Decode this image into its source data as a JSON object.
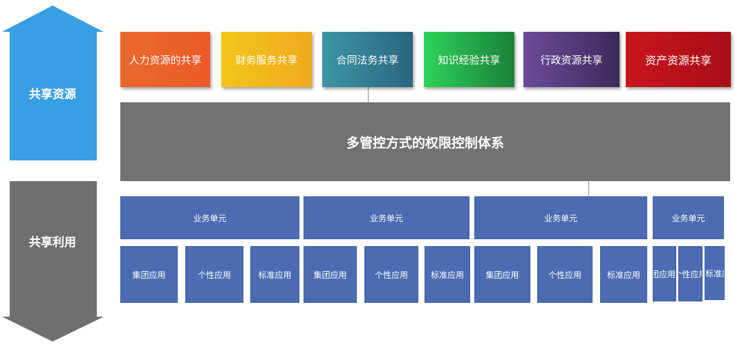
{
  "arrows": {
    "up_label": "共享资源",
    "down_label": "共享利用",
    "up_color": "#3a9ee4",
    "down_color": "#6f6f6f"
  },
  "resources": [
    {
      "label": "人力资源的共享",
      "color": "#e9692c"
    },
    {
      "label": "财务服务共享",
      "color": "#f2b81c"
    },
    {
      "label": "合同法务共享",
      "color": "#34849a"
    },
    {
      "label": "知识经验共享",
      "color": "#27c24c"
    },
    {
      "label": "行政资源共享",
      "color": "#5e3f86"
    },
    {
      "label": "资产资源共享",
      "color": "#c1141c"
    }
  ],
  "core": {
    "label": "多管控方式的权限控制体系",
    "color": "#727272"
  },
  "units": [
    {
      "label": "业务单元",
      "apps": [
        "集团应用",
        "个性应用",
        "标准应用"
      ]
    },
    {
      "label": "业务单元",
      "apps": [
        "集团应用",
        "个性应用",
        "标准应用"
      ]
    },
    {
      "label": "业务单元",
      "apps": [
        "集团应用",
        "个性应用",
        "标准应用"
      ]
    },
    {
      "label": "业务单元",
      "apps": [
        "集团应用",
        "个性应用",
        "标准应用"
      ]
    }
  ],
  "unit_color": "#4b6cb2"
}
